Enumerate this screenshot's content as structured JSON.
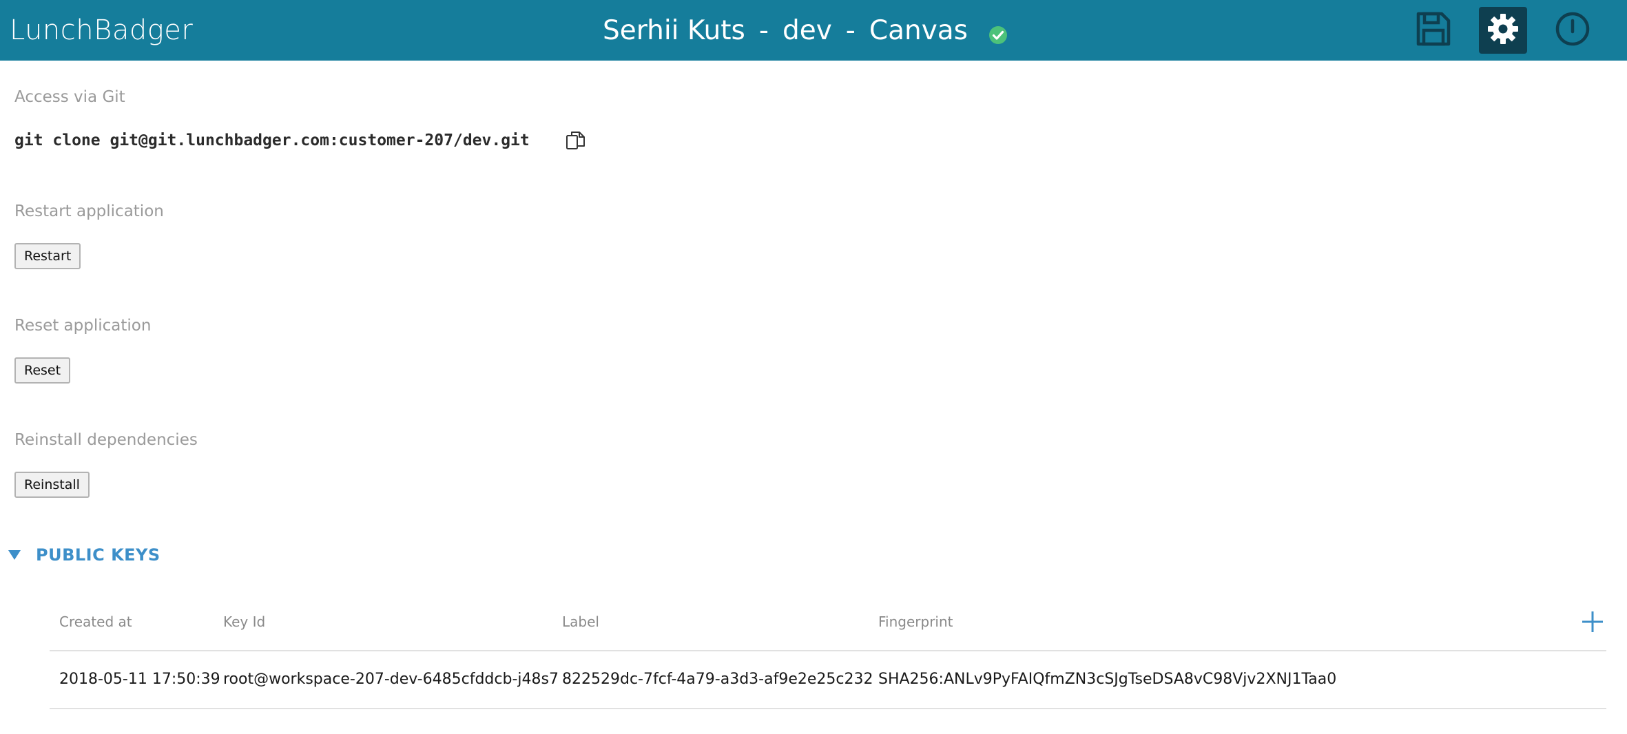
{
  "header": {
    "logo": "LunchBadger",
    "user": "Serhii Kuts",
    "separator": "-",
    "environment": "dev",
    "view": "Canvas",
    "status_icon": "check-circle-icon",
    "actions": [
      {
        "name": "save",
        "icon": "floppy-disk-icon"
      },
      {
        "name": "settings",
        "icon": "gear-icon"
      },
      {
        "name": "power",
        "icon": "power-icon"
      }
    ]
  },
  "git": {
    "label": "Access via Git",
    "command": "git clone git@git.lunchbadger.com:customer-207/dev.git",
    "copy_icon": "copy-icon"
  },
  "restart": {
    "label": "Restart application",
    "button": "Restart"
  },
  "reset": {
    "label": "Reset application",
    "button": "Reset"
  },
  "reinstall": {
    "label": "Reinstall dependencies",
    "button": "Reinstall"
  },
  "public_keys": {
    "title": "PUBLIC KEYS",
    "columns": [
      "Created at",
      "Key Id",
      "Label",
      "Fingerprint"
    ],
    "rows": [
      {
        "created_at": "2018-05-11 17:50:39",
        "key_id": "root@workspace-207-dev-6485cfddcb-j48s7",
        "label": "822529dc-7fcf-4a79-a3d3-af9e2e25c232",
        "fingerprint": "SHA256:ANLv9PyFAIQfmZN3cSJgTseDSA8vC98Vjv2XNJ1Taa0"
      }
    ]
  },
  "colors": {
    "header_bg": "#157d9b",
    "settings_active_bg": "#0e3f50",
    "status_green": "#4cc27a",
    "accent_blue": "#3d8fc9"
  }
}
